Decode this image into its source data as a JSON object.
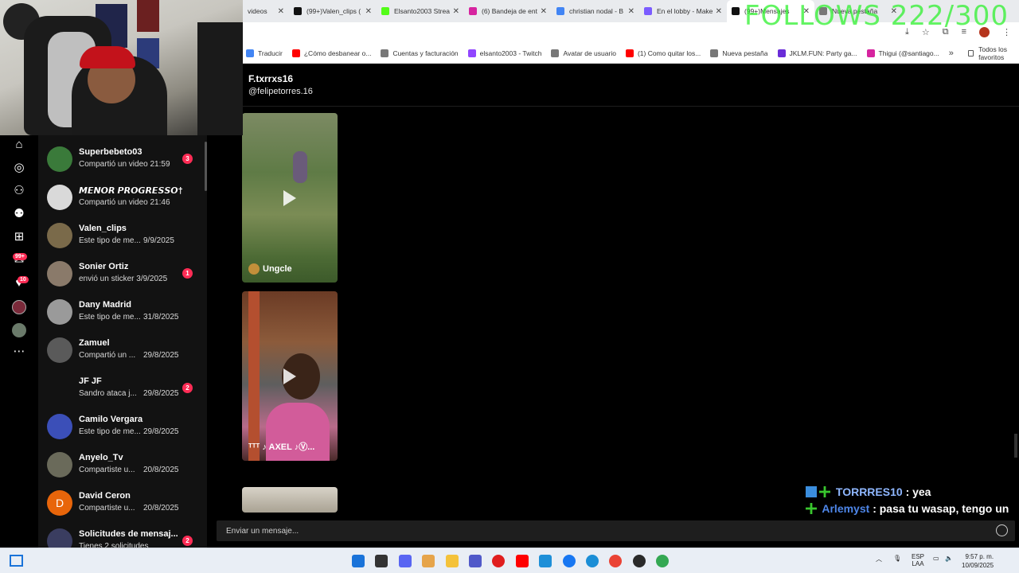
{
  "overlay": {
    "follows_goal": "FOLLOWS 222/300",
    "chat": [
      {
        "user": "TORRRES10",
        "message": ": yea"
      },
      {
        "user": "Arlemyst",
        "message": ": pasa tu wasap, tengo un intento"
      }
    ]
  },
  "browser": {
    "tabs": [
      {
        "label": "videos",
        "icon_color": "#ffffff"
      },
      {
        "label": "(99+)Valen_clips (",
        "icon_color": "#111111"
      },
      {
        "label": "Elsanto2003 Strea",
        "icon_color": "#53fc18"
      },
      {
        "label": "(6) Bandeja de ent",
        "icon_color": "#d6249f"
      },
      {
        "label": "christian nodal - B",
        "icon_color": "#4285f4"
      },
      {
        "label": "En el lobby - Make",
        "icon_color": "#7b5cff"
      },
      {
        "label": "(99+)Mensajes",
        "icon_color": "#111111"
      },
      {
        "label": "Nueva pestaña",
        "icon_color": "#777777"
      }
    ],
    "close_glyph": "✕",
    "bookmarks": [
      {
        "label": "Traducir",
        "icon_color": "#4285f4"
      },
      {
        "label": "¿Cómo desbanear o...",
        "icon_color": "#ff0000"
      },
      {
        "label": "Cuentas y facturación",
        "icon_color": "#777777"
      },
      {
        "label": "elsanto2003 - Twitch",
        "icon_color": "#9146ff"
      },
      {
        "label": "Avatar de usuario",
        "icon_color": "#777777"
      },
      {
        "label": "(1) Como quitar los...",
        "icon_color": "#ff0000"
      },
      {
        "label": "Nueva pestaña",
        "icon_color": "#777777"
      },
      {
        "label": "JKLM.FUN: Party ga...",
        "icon_color": "#6a2cd8"
      },
      {
        "label": "Thigui (@santiago...",
        "icon_color": "#d6249f"
      }
    ],
    "bookmarks_more": "»",
    "all_bookmarks": "Todos los favoritos"
  },
  "rail": {
    "messages_badge": "99+",
    "activity_badge": "10"
  },
  "conversations": [
    {
      "name": "Superbebeto03",
      "preview": "Compartió un video 21:59",
      "time": "",
      "badge": "3",
      "avatar_color": "#3a7a3a"
    },
    {
      "name": "𝙈𝙀𝙉𝙊𝙍 𝙋𝙍𝙊𝙂𝙍𝙀𝙎𝙎𝙊†",
      "preview": "Compartió un video 21:46",
      "time": "",
      "badge": "",
      "avatar_color": "#d9d9d9"
    },
    {
      "name": "Valen_clips",
      "preview": "Este tipo de me...",
      "time": "9/9/2025",
      "badge": "",
      "avatar_color": "#7a6a4a"
    },
    {
      "name": "Sonier Ortiz",
      "preview": "envió un sticker 3/9/2025",
      "time": "",
      "badge": "1",
      "avatar_color": "#8a7a6a"
    },
    {
      "name": "Dany Madrid",
      "preview": "Este tipo de me...",
      "time": "31/8/2025",
      "badge": "",
      "avatar_color": "#9a9a9a"
    },
    {
      "name": "Zamuel",
      "preview": "Compartió un ...",
      "time": "29/8/2025",
      "badge": "",
      "avatar_color": "#5a5a5a"
    },
    {
      "name": "JF JF",
      "preview": "Sandro ataca j...",
      "time": "29/8/2025",
      "badge": "2",
      "avatar_color": "#121212"
    },
    {
      "name": "Camilo Vergara",
      "preview": "Este tipo de me...",
      "time": "29/8/2025",
      "badge": "",
      "avatar_color": "#3b4fb8"
    },
    {
      "name": "Anyelo_Tv",
      "preview": "Compartiste u...",
      "time": "20/8/2025",
      "badge": "",
      "avatar_color": "#6a6a5a"
    },
    {
      "name": "David Ceron",
      "preview": "Compartiste u...",
      "time": "20/8/2025",
      "badge": "",
      "avatar_color": "#e8650a",
      "initial": "D"
    },
    {
      "name": "Solicitudes de mensaj...",
      "preview": "Tienes 2 solicitudes",
      "time": "",
      "badge": "2",
      "avatar_color": "#3a3d60"
    }
  ],
  "chat": {
    "display_name": "F.txrrxs16",
    "handle": "@felipetorres.16",
    "videos": [
      {
        "author": "Ungcle"
      },
      {
        "author": "ᵀᵀᵀ ♪ AXEL ♪Ⓥ..."
      }
    ],
    "input_placeholder": "Enviar un mensaje..."
  },
  "taskbar": {
    "language": "ESP",
    "layout": "LAA",
    "time": "9:57 p. m.",
    "date": "10/09/2025",
    "apps": [
      {
        "name": "start",
        "color": "#1a73d9"
      },
      {
        "name": "file-viewer",
        "color": "#333333"
      },
      {
        "name": "discord",
        "color": "#5865f2"
      },
      {
        "name": "copilot",
        "color": "#e6a44a"
      },
      {
        "name": "file-explorer",
        "color": "#f4c23a"
      },
      {
        "name": "teams",
        "color": "#5059c9"
      },
      {
        "name": "opera",
        "color": "#e01e1e"
      },
      {
        "name": "youtube",
        "color": "#ff0000"
      },
      {
        "name": "store",
        "color": "#1e8fd8"
      },
      {
        "name": "facebook",
        "color": "#1877f2"
      },
      {
        "name": "edge",
        "color": "#1b8ed6"
      },
      {
        "name": "chrome",
        "color": "#ea4335"
      },
      {
        "name": "obs",
        "color": "#2a2a2a"
      },
      {
        "name": "chrome-2",
        "color": "#34a853"
      }
    ]
  }
}
